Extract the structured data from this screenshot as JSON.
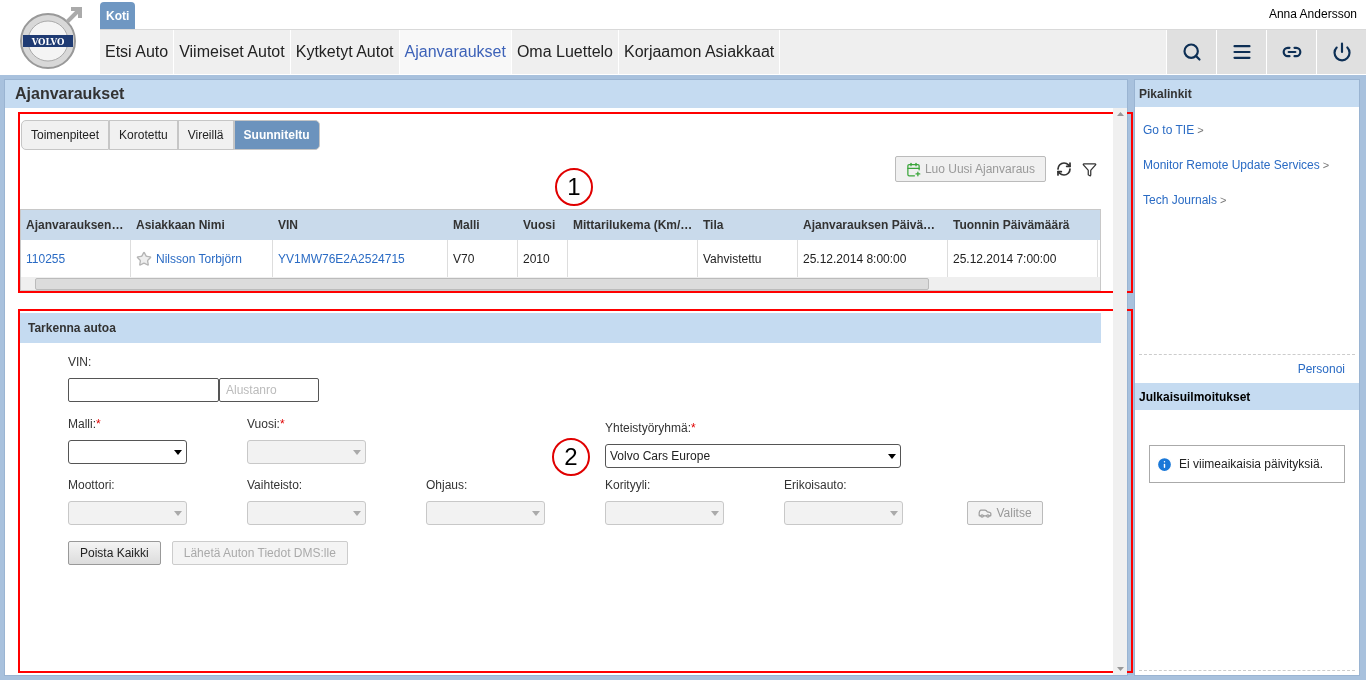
{
  "header": {
    "logo_text": "VOLVO",
    "home_tab": "Koti",
    "user": "Anna Andersson",
    "nav": [
      {
        "label": "Etsi Auto",
        "selected": false
      },
      {
        "label": "Viimeiset Autot",
        "selected": false
      },
      {
        "label": "Kytketyt Autot",
        "selected": false
      },
      {
        "label": "Ajanvaraukset",
        "selected": true
      },
      {
        "label": "Oma Luettelo",
        "selected": false
      },
      {
        "label": "Korjaamon Asiakkaat",
        "selected": false
      }
    ]
  },
  "main": {
    "title": "Ajanvaraukset",
    "tabs": [
      {
        "label": "Toimenpiteet",
        "selected": false
      },
      {
        "label": "Korotettu",
        "selected": false
      },
      {
        "label": "Vireillä",
        "selected": false
      },
      {
        "label": "Suunniteltu",
        "selected": true
      }
    ],
    "create_button": {
      "label": "Luo Uusi Ajanvaraus",
      "disabled": true
    },
    "table": {
      "columns": [
        "Ajanvarauksen…",
        "Asiakkaan Nimi",
        "VIN",
        "Malli",
        "Vuosi",
        "Mittarilukema (Km/…",
        "Tila",
        "Ajanvarauksen Päivä…",
        "Tuonnin Päivämäärä"
      ],
      "rows": [
        {
          "favorite": false,
          "cells": [
            {
              "text": "110255",
              "link": true
            },
            {
              "text": "Nilsson Torbjörn",
              "link": true
            },
            {
              "text": "YV1MW76E2A2524715",
              "link": true
            },
            {
              "text": "V70",
              "link": false
            },
            {
              "text": "2010",
              "link": false
            },
            null,
            {
              "text": "Vahvistettu",
              "link": false
            },
            {
              "text": "25.12.2014 8:00:00",
              "link": false
            },
            {
              "text": "25.12.2014 7:00:00",
              "link": false
            }
          ]
        }
      ]
    },
    "form": {
      "title": "Tarkenna autoa",
      "vin": {
        "label": "VIN:",
        "placeholder": "Alustanro"
      },
      "required_mark": "*",
      "rows": [
        [
          {
            "label": "Malli:",
            "required": true,
            "disabled": false
          },
          {
            "label": "Vuosi:",
            "required": true,
            "disabled": true
          },
          "",
          {
            "label": "Yhteistyöryhmä:",
            "required": true,
            "value": "Volvo Cars Europe",
            "disabled": false
          }
        ],
        [
          {
            "label": "Moottori:",
            "required": false,
            "disabled": true
          },
          {
            "label": "Vaihteisto:",
            "required": false,
            "disabled": true
          },
          {
            "label": "Ohjaus:",
            "required": false,
            "disabled": true
          },
          {
            "label": "Korityyli:",
            "required": false,
            "disabled": true
          },
          {
            "label": "Erikoisauto:",
            "required": false,
            "disabled": true
          }
        ]
      ],
      "select_button": {
        "label": "Valitse",
        "disabled": true
      },
      "buttons": [
        {
          "label": "Poista Kaikki",
          "disabled": false
        },
        {
          "label": "Lähetä Auton Tiedot DMS:lle",
          "disabled": true
        }
      ]
    }
  },
  "sidebar": {
    "title": "Pikalinkit",
    "links": [
      {
        "label": "Go to TIE",
        "marker": ">"
      },
      {
        "label": "Monitor Remote Update Services",
        "marker": ">"
      },
      {
        "label": "Tech Journals",
        "marker": ">"
      }
    ],
    "personalize": "Personoi",
    "notices_title": "Julkaisuilmoitukset",
    "notice": "Ei viimeaikaisia päivityksiä."
  },
  "annotations": [
    {
      "label": "1"
    },
    {
      "label": "2"
    }
  ]
}
